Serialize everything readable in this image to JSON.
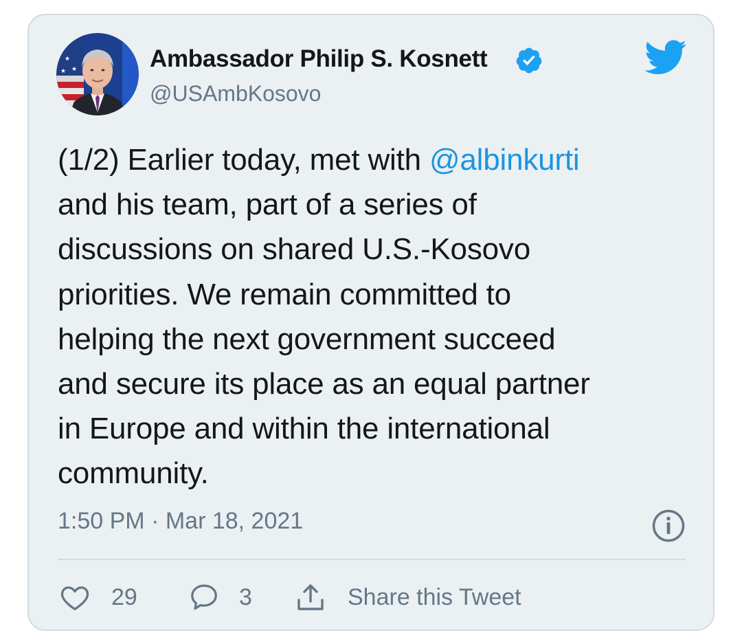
{
  "author": {
    "name": "Ambassador Philip S. Kosnett",
    "handle": "@USAmbKosovo",
    "verified": true
  },
  "tweet": {
    "lines": [
      {
        "before": "(1/2) Earlier today, met with ",
        "mention": "@albinkurti"
      },
      {
        "text": "and his team, part of a series of"
      },
      {
        "text": "discussions on shared U.S.-Kosovo"
      },
      {
        "text": "priorities. We remain committed to"
      },
      {
        "text": "helping the next government succeed"
      },
      {
        "text": "and secure its place as an equal partner"
      },
      {
        "text": "in Europe and within the international"
      },
      {
        "text": "community."
      }
    ],
    "timestamp": "1:50 PM · Mar 18, 2021"
  },
  "actions": {
    "likes": "29",
    "replies": "3",
    "share_label": "Share this Tweet"
  },
  "icons": {
    "verified": "verified-badge-icon",
    "brand": "twitter-bird-icon",
    "info": "info-icon",
    "like": "heart-icon",
    "reply": "speech-bubble-icon",
    "share": "share-icon"
  },
  "colors": {
    "card_background": "#ebf0f3",
    "card_border": "#d2dbe1",
    "text": "#14171a",
    "secondary_text": "#657786",
    "accent": "#1b95e0"
  }
}
